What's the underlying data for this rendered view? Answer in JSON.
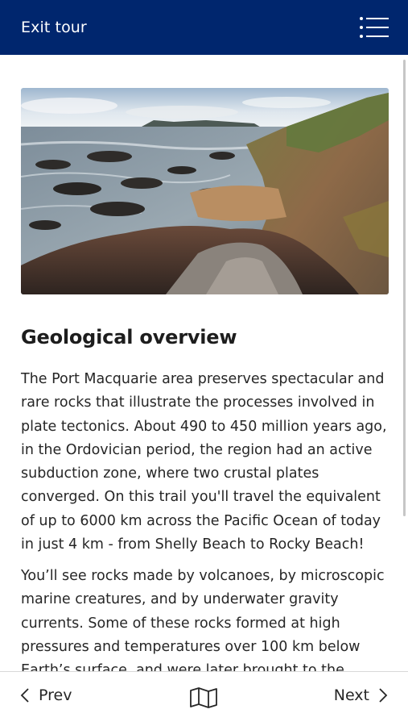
{
  "header": {
    "exit_label": "Exit tour",
    "menu_icon": "list-menu-icon"
  },
  "hero_image": {
    "description_icon": "coastline-photo"
  },
  "article": {
    "heading": "Geological overview",
    "paragraph1": "The Port Macquarie area preserves spectacular and rare rocks that illustrate the processes involved in plate tectonics. About 490 to 450 million years ago, in the Ordovician period, the region had an active subduction zone, where two crustal plates converged. On this trail you'll travel the equivalent of up to 6000 km across the Pacific Ocean of today in just 4 km - from Shelly Beach to Rocky Beach!",
    "paragraph2": "You’ll see rocks made by volcanoes, by microscopic marine creatures, and by underwater gravity currents. Some of these rocks formed at high pressures and temperatures over 100 km below Earth’s surface, and were later brought to the"
  },
  "footer": {
    "prev_label": "Prev",
    "next_label": "Next",
    "map_icon": "map-icon"
  },
  "colors": {
    "header_bg": "#00266e",
    "text": "#262626"
  }
}
